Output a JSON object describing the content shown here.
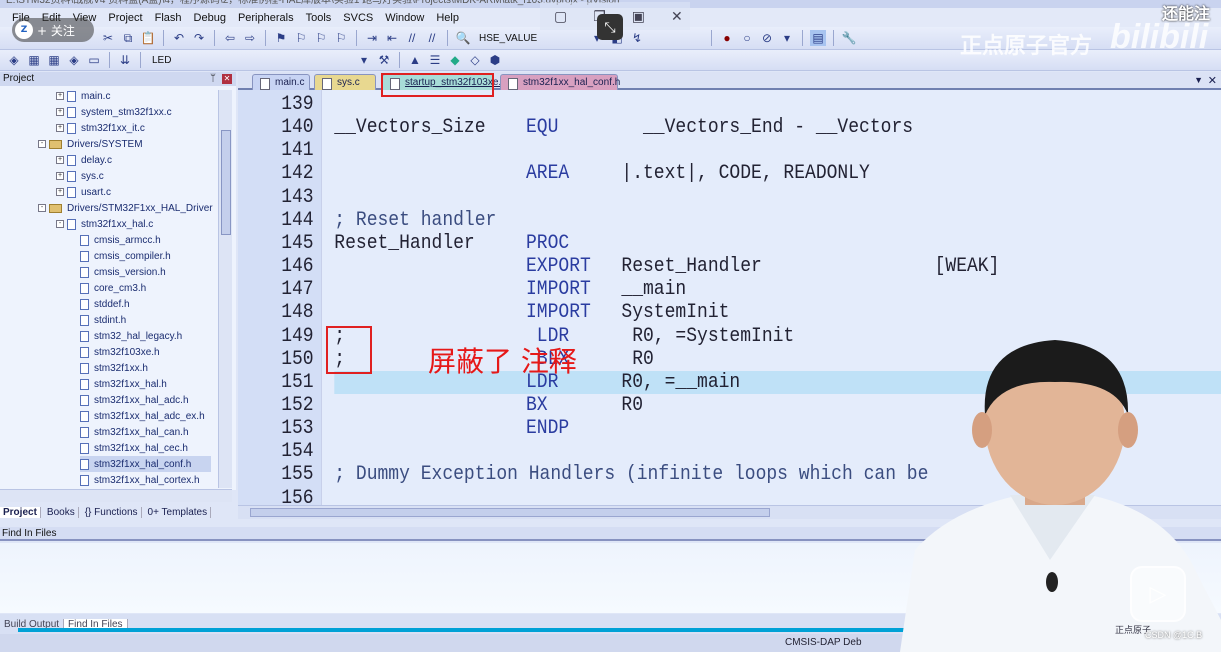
{
  "window": {
    "title": "E:\\STM32资料\\战舰V4 资料盘(A盘)\\4，程序源码\\2，标准例程-HAL库版本\\实验1 跑马灯实验\\Projects\\MDK-ARM\\atk_f103.uvprojx - µVision"
  },
  "menu": [
    "File",
    "Edit",
    "View",
    "Project",
    "Flash",
    "Debug",
    "Peripherals",
    "Tools",
    "SVCS",
    "Window",
    "Help"
  ],
  "toolbar": {
    "find_field": "HSE_VALUE",
    "target": "LED"
  },
  "project_panel": {
    "title": "Project",
    "tree": [
      {
        "label": "main.c",
        "level": 2,
        "type": "file",
        "expander": "+"
      },
      {
        "label": "system_stm32f1xx.c",
        "level": 2,
        "type": "file",
        "expander": "+"
      },
      {
        "label": "stm32f1xx_it.c",
        "level": 2,
        "type": "file",
        "expander": "+"
      },
      {
        "label": "Drivers/SYSTEM",
        "level": 1,
        "type": "folder",
        "expander": "-"
      },
      {
        "label": "delay.c",
        "level": 2,
        "type": "file",
        "expander": "+"
      },
      {
        "label": "sys.c",
        "level": 2,
        "type": "file",
        "expander": "+"
      },
      {
        "label": "usart.c",
        "level": 2,
        "type": "file",
        "expander": "+"
      },
      {
        "label": "Drivers/STM32F1xx_HAL_Driver",
        "level": 1,
        "type": "folder",
        "expander": "-"
      },
      {
        "label": "stm32f1xx_hal.c",
        "level": 2,
        "type": "file",
        "expander": "-"
      },
      {
        "label": "cmsis_armcc.h",
        "level": 3,
        "type": "file"
      },
      {
        "label": "cmsis_compiler.h",
        "level": 3,
        "type": "file"
      },
      {
        "label": "cmsis_version.h",
        "level": 3,
        "type": "file"
      },
      {
        "label": "core_cm3.h",
        "level": 3,
        "type": "file"
      },
      {
        "label": "stddef.h",
        "level": 3,
        "type": "file"
      },
      {
        "label": "stdint.h",
        "level": 3,
        "type": "file"
      },
      {
        "label": "stm32_hal_legacy.h",
        "level": 3,
        "type": "file"
      },
      {
        "label": "stm32f103xe.h",
        "level": 3,
        "type": "file"
      },
      {
        "label": "stm32f1xx.h",
        "level": 3,
        "type": "file"
      },
      {
        "label": "stm32f1xx_hal.h",
        "level": 3,
        "type": "file"
      },
      {
        "label": "stm32f1xx_hal_adc.h",
        "level": 3,
        "type": "file"
      },
      {
        "label": "stm32f1xx_hal_adc_ex.h",
        "level": 3,
        "type": "file"
      },
      {
        "label": "stm32f1xx_hal_can.h",
        "level": 3,
        "type": "file"
      },
      {
        "label": "stm32f1xx_hal_cec.h",
        "level": 3,
        "type": "file"
      },
      {
        "label": "stm32f1xx_hal_conf.h",
        "level": 3,
        "type": "file",
        "selected": true
      },
      {
        "label": "stm32f1xx_hal_cortex.h",
        "level": 3,
        "type": "file"
      }
    ],
    "tabs": [
      "Project",
      "Books",
      "{} Functions",
      "0+ Templates"
    ]
  },
  "editor": {
    "tabs": [
      {
        "label": "main.c",
        "color": "#c8d4f4"
      },
      {
        "label": "sys.c",
        "color": "#e8d890"
      },
      {
        "label": "startup_stm32f103xe.s*",
        "color": "#a8dcd8",
        "active": true
      },
      {
        "label": "stm32f1xx_hal_conf.h",
        "color": "#d8a0c0"
      }
    ],
    "lines": [
      {
        "num": "139"
      },
      {
        "num": "140",
        "label": "__Vectors_Size",
        "op": "EQU",
        "arg": "  __Vectors_End - __Vectors"
      },
      {
        "num": "141"
      },
      {
        "num": "142",
        "op": "AREA",
        "arg": "|.text|, CODE, READONLY"
      },
      {
        "num": "143"
      },
      {
        "num": "144",
        "comment": "; Reset handler"
      },
      {
        "num": "145",
        "label": "Reset_Handler",
        "op": "PROC"
      },
      {
        "num": "146",
        "op": "EXPORT",
        "arg": "Reset_Handler",
        "ext": "[WEAK]"
      },
      {
        "num": "147",
        "op": "IMPORT",
        "arg": "__main"
      },
      {
        "num": "148",
        "op": "IMPORT",
        "arg": "SystemInit"
      },
      {
        "num": "149",
        "label": ";",
        "op": " LDR",
        "arg": " R0, =SystemInit"
      },
      {
        "num": "150",
        "label": ";",
        "op": " BLX",
        "arg": " R0"
      },
      {
        "num": "151",
        "op": "LDR",
        "arg": "R0, =__main",
        "current": true
      },
      {
        "num": "152",
        "op": "BX",
        "arg": "R0"
      },
      {
        "num": "153",
        "op": "ENDP"
      },
      {
        "num": "154"
      },
      {
        "num": "155",
        "comment": "; Dummy Exception Handlers (infinite loops which can be"
      },
      {
        "num": "156"
      }
    ],
    "annotation": "屏蔽了 注释",
    "annotation_color": "#e61818"
  },
  "find_in_files": {
    "title": "Find In Files"
  },
  "output_tabs": [
    "Build Output",
    "Find In Files"
  ],
  "status": {
    "debugger": "CMSIS-DAP Deb"
  },
  "video": {
    "progress": 0.84,
    "follow_label": "+ 关注",
    "channel_logo": "正点原子",
    "watermark_brand": "正点原子官方",
    "watermark_site": "bilibili",
    "top_overlay": "还能注",
    "csdn": "CSDN @1C.B",
    "corner_brand": "正点原子",
    "accent": "#00a1d6"
  }
}
